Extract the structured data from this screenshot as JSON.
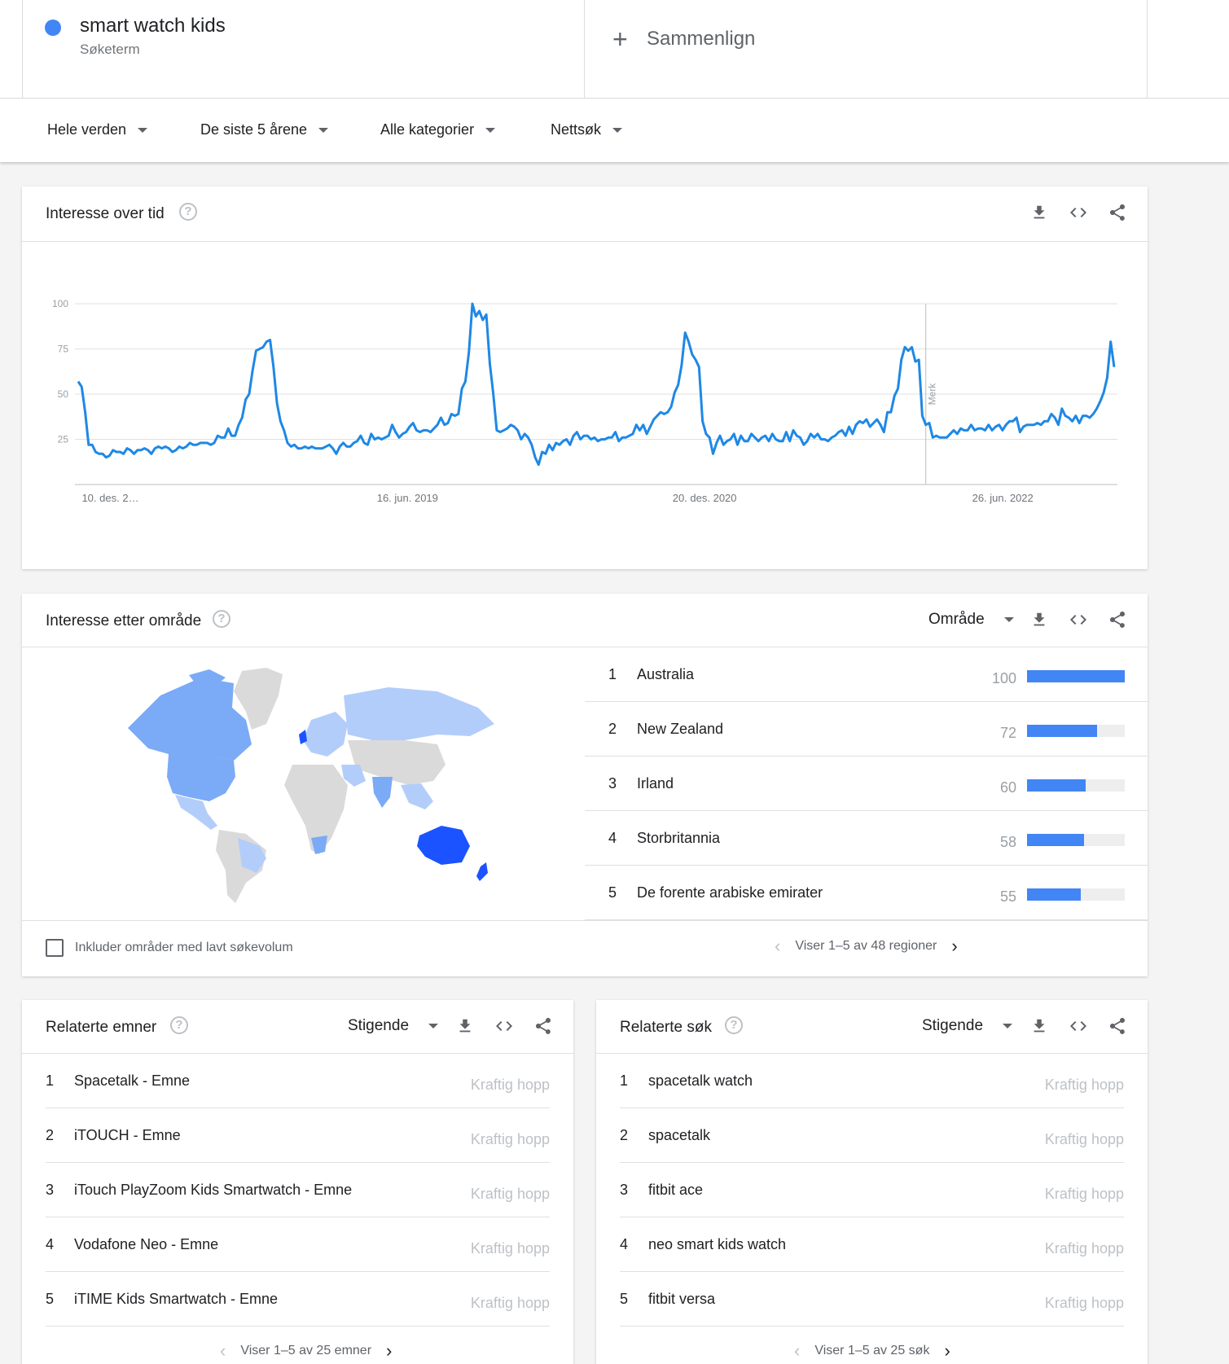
{
  "term": {
    "name": "smart watch kids",
    "type": "Søketerm",
    "color": "#4285f4"
  },
  "compare": {
    "icon": "plus-icon",
    "label": "Sammenlign"
  },
  "filters": [
    {
      "label": "Hele verden"
    },
    {
      "label": "De siste 5 årene"
    },
    {
      "label": "Alle kategorier"
    },
    {
      "label": "Nettsøk"
    }
  ],
  "interest_over_time": {
    "title": "Interesse over tid",
    "marker_label": "Merk"
  },
  "chart_data": {
    "type": "line",
    "x_tick_labels": [
      "10. des. 2…",
      "16. jun. 2019",
      "20. des. 2020",
      "26. jun. 2022"
    ],
    "y_ticks": [
      25,
      50,
      75,
      100
    ],
    "ylim": [
      0,
      100
    ],
    "grid": true,
    "color": "#1e88e5",
    "series": [
      {
        "values": [
          57,
          54,
          40,
          22,
          22,
          18,
          17,
          17,
          15,
          16,
          19,
          18,
          18,
          17,
          20,
          19,
          17,
          19,
          19,
          20,
          19,
          17,
          20,
          21,
          20,
          21,
          20,
          18,
          19,
          21,
          20,
          21,
          23,
          22,
          22,
          23,
          23,
          23,
          22,
          23,
          27,
          26,
          26,
          31,
          27,
          27,
          33,
          37,
          47,
          50,
          63,
          74,
          75,
          76,
          79,
          80,
          65,
          45,
          35,
          30,
          23,
          21,
          22,
          20,
          20,
          21,
          20,
          21,
          20,
          20,
          20,
          21,
          22,
          20,
          17,
          21,
          23,
          21,
          21,
          23,
          24,
          27,
          23,
          22,
          28,
          25,
          26,
          25,
          26,
          27,
          33,
          29,
          26,
          28,
          29,
          32,
          34,
          30,
          29,
          30,
          30,
          29,
          31,
          33,
          37,
          33,
          34,
          39,
          38,
          39,
          53,
          57,
          73,
          100,
          93,
          96,
          91,
          94,
          67,
          50,
          30,
          29,
          30,
          31,
          33,
          32,
          30,
          25,
          28,
          26,
          22,
          15,
          11,
          18,
          17,
          22,
          19,
          23,
          22,
          24,
          25,
          22,
          27,
          29,
          25,
          27,
          27,
          25,
          26,
          24,
          25,
          25,
          26,
          26,
          29,
          24,
          26,
          26,
          27,
          28,
          33,
          30,
          33,
          28,
          32,
          36,
          38,
          40,
          39,
          40,
          43,
          51,
          55,
          66,
          84,
          79,
          72,
          69,
          65,
          35,
          28,
          26,
          17,
          23,
          27,
          22,
          24,
          25,
          28,
          22,
          27,
          24,
          24,
          28,
          26,
          24,
          26,
          27,
          24,
          28,
          25,
          24,
          24,
          29,
          24,
          30,
          27,
          26,
          22,
          24,
          28,
          26,
          28,
          25,
          25,
          24,
          26,
          27,
          29,
          30,
          27,
          32,
          28,
          33,
          35,
          34,
          36,
          32,
          34,
          36,
          33,
          29,
          40,
          40,
          49,
          53,
          69,
          76,
          74,
          76,
          68,
          69,
          38,
          33,
          34,
          26,
          27,
          26,
          26,
          26,
          28,
          30,
          28,
          31,
          30,
          30,
          33,
          30,
          31,
          31,
          30,
          33,
          30,
          32,
          33,
          30,
          33,
          35,
          35,
          37,
          29,
          32,
          33,
          33,
          33,
          34,
          33,
          35,
          35,
          39,
          37,
          33,
          42,
          38,
          37,
          35,
          38,
          34,
          38,
          38,
          37,
          39,
          42,
          46,
          51,
          59,
          79,
          65
        ]
      }
    ]
  },
  "interest_by_region": {
    "title": "Interesse etter område",
    "select_label": "Område",
    "rows": [
      {
        "rank": "1",
        "name": "Australia",
        "value": "100",
        "level": 100
      },
      {
        "rank": "2",
        "name": "New Zealand",
        "value": "72",
        "level": 72
      },
      {
        "rank": "3",
        "name": "Irland",
        "value": "60",
        "level": 60
      },
      {
        "rank": "4",
        "name": "Storbritannia",
        "value": "58",
        "level": 58
      },
      {
        "rank": "5",
        "name": "De forente arabiske emirater",
        "value": "55",
        "level": 55
      }
    ],
    "checkbox_label": "Inkluder områder med lavt søkevolum",
    "pager_text": "Viser 1–5 av 48 regioner",
    "map_colors": {
      "high": "#1a53ff",
      "mid": "#7baaf7",
      "low": "#b3cdfb",
      "none": "#dadada"
    }
  },
  "related_topics": {
    "title": "Relaterte emner",
    "select_label": "Stigende",
    "rows": [
      {
        "rank": "1",
        "name": "Spacetalk - Emne",
        "value": "Kraftig hopp"
      },
      {
        "rank": "2",
        "name": "iTOUCH - Emne",
        "value": "Kraftig hopp"
      },
      {
        "rank": "3",
        "name": "iTouch PlayZoom Kids Smartwatch - Emne",
        "value": "Kraftig hopp"
      },
      {
        "rank": "4",
        "name": "Vodafone Neo - Emne",
        "value": "Kraftig hopp"
      },
      {
        "rank": "5",
        "name": "iTIME Kids Smartwatch - Emne",
        "value": "Kraftig hopp"
      }
    ],
    "pager_text": "Viser 1–5 av 25 emner"
  },
  "related_queries": {
    "title": "Relaterte søk",
    "select_label": "Stigende",
    "rows": [
      {
        "rank": "1",
        "name": "spacetalk watch",
        "value": "Kraftig hopp"
      },
      {
        "rank": "2",
        "name": "spacetalk",
        "value": "Kraftig hopp"
      },
      {
        "rank": "3",
        "name": "fitbit ace",
        "value": "Kraftig hopp"
      },
      {
        "rank": "4",
        "name": "neo smart kids watch",
        "value": "Kraftig hopp"
      },
      {
        "rank": "5",
        "name": "fitbit versa",
        "value": "Kraftig hopp"
      }
    ],
    "pager_text": "Viser 1–5 av 25 søk"
  }
}
